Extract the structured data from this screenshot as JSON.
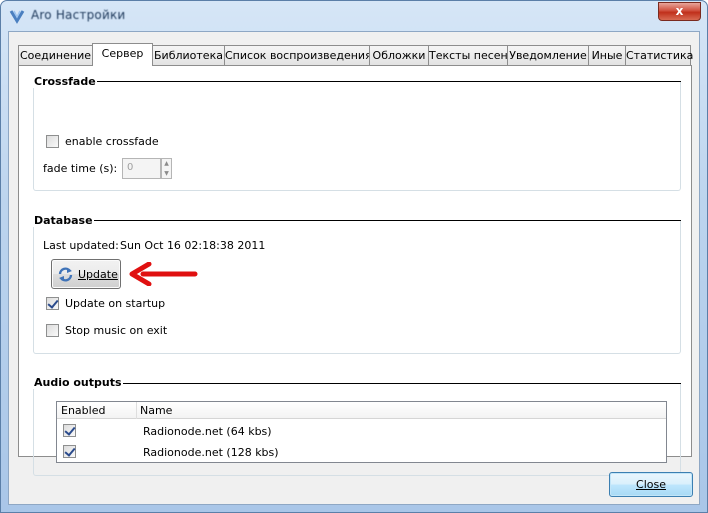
{
  "window": {
    "title": "Aro Настройки",
    "close_glyph": "x"
  },
  "tabs": [
    {
      "label": "Соединение",
      "active": false
    },
    {
      "label": "Сервер",
      "active": true
    },
    {
      "label": "Библиотека",
      "active": false
    },
    {
      "label": "Список воспроизведения",
      "active": false
    },
    {
      "label": "Обложки",
      "active": false
    },
    {
      "label": "Тексты песен",
      "active": false
    },
    {
      "label": "Уведомление",
      "active": false
    },
    {
      "label": "Иные",
      "active": false
    },
    {
      "label": "Статистика",
      "active": false
    }
  ],
  "crossfade": {
    "title": "Crossfade",
    "enable_label": "enable crossfade",
    "enable_checked": false,
    "fade_time_label": "fade time (s):",
    "fade_time_value": "0"
  },
  "database": {
    "title": "Database",
    "last_updated_label": "Last updated:",
    "last_updated_value": "Sun Oct 16 02:18:38 2011",
    "update_button": "Update",
    "update_on_startup_label": "Update on startup",
    "update_on_startup_checked": true,
    "stop_music_label": "Stop music on exit",
    "stop_music_checked": false
  },
  "audio_outputs": {
    "title": "Audio outputs",
    "columns": [
      "Enabled",
      "Name"
    ],
    "rows": [
      {
        "enabled": true,
        "name": "Radionode.net (64 kbs)"
      },
      {
        "enabled": true,
        "name": "Radionode.net (128 kbs)"
      }
    ]
  },
  "footer": {
    "close_label": "Close"
  },
  "colors": {
    "annotation_arrow": "#e01010",
    "window_frame": "#a9c6e8",
    "default_button": "#3c7fb1"
  },
  "icons": {
    "app": "app-icon",
    "refresh": "refresh-icon",
    "annotation": "red-arrow-icon"
  }
}
